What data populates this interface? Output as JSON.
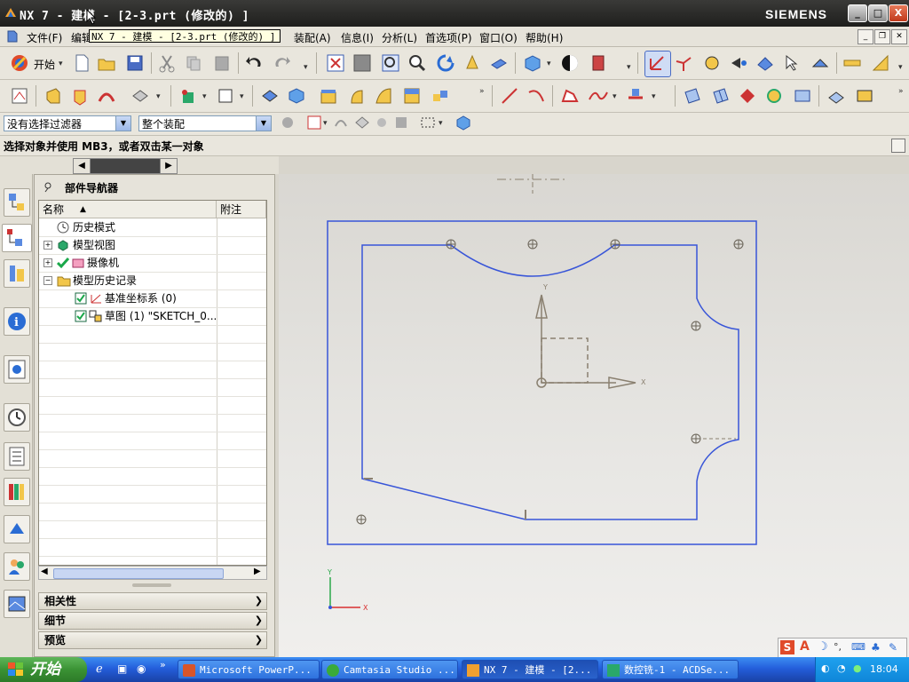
{
  "window": {
    "title": "NX 7 - 建模 - [2-3.prt (修改的) ]",
    "brand": "SIEMENS",
    "controls": [
      "_",
      "□",
      "X"
    ]
  },
  "menubar": {
    "items": [
      "文件(F)",
      "编辑",
      "装配(A)",
      "信息(I)",
      "分析(L)",
      "首选项(P)",
      "窗口(O)",
      "帮助(H)"
    ],
    "tooltip": "NX 7 - 建模 - [2-3.prt (修改的) ]"
  },
  "toolbar": {
    "start_label": "开始"
  },
  "filters": {
    "selection_filter": "没有选择过滤器",
    "assembly_scope": "整个装配"
  },
  "status": {
    "prompt": "选择对象并使用 MB3，或者双击某一对象"
  },
  "navigator": {
    "title": "部件导航器",
    "columns": [
      "名称",
      "附注"
    ],
    "rows": [
      {
        "label": "历史模式",
        "indent": 0
      },
      {
        "label": "模型视图",
        "indent": 0
      },
      {
        "label": "摄像机",
        "indent": 0
      },
      {
        "label": "模型历史记录",
        "indent": 0
      },
      {
        "label": "基准坐标系 (0)",
        "indent": 1
      },
      {
        "label": "草图 (1) \"SKETCH_0...",
        "indent": 1
      }
    ],
    "panels": [
      "相关性",
      "细节",
      "预览"
    ]
  },
  "canvas": {
    "axis_x": "X",
    "axis_y": "Y",
    "triad_x": "X",
    "triad_y": "Y"
  },
  "taskbar": {
    "start": "开始",
    "tasks": [
      "Microsoft PowerP...",
      "Camtasia Studio ...",
      "NX 7 - 建模 - [2...",
      "数控铣-1 - ACDSe..."
    ],
    "clock": "18:04"
  }
}
